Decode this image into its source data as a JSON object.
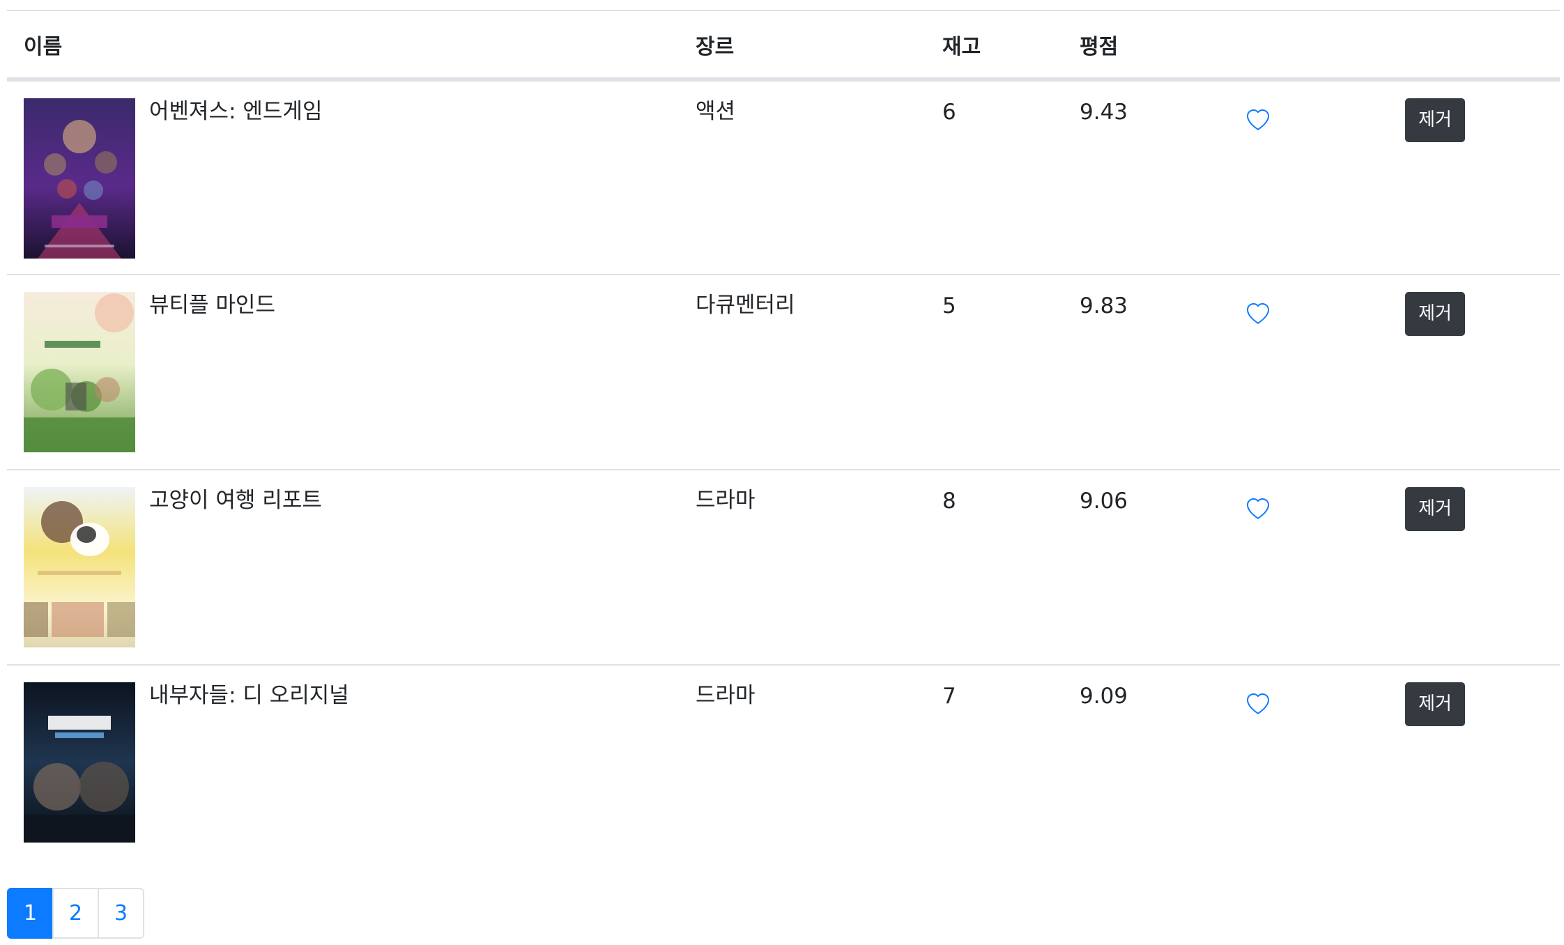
{
  "table": {
    "headers": {
      "title": "이름",
      "genre": "장르",
      "stock": "재고",
      "rate": "평점"
    },
    "rows": [
      {
        "poster_icon": "movie-poster-image",
        "poster_colors": [
          "#2b1b4a",
          "#7b2fa0",
          "#c43a6e"
        ],
        "title": "어벤져스: 엔드게임",
        "genre": "액션",
        "stock": "6",
        "rate": "9.43",
        "remove_label": "제거"
      },
      {
        "poster_icon": "movie-poster-image",
        "poster_colors": [
          "#f3e7d6",
          "#8dbf6c",
          "#3f7a3a"
        ],
        "title": "뷰티플 마인드",
        "genre": "다큐멘터리",
        "stock": "5",
        "rate": "9.83",
        "remove_label": "제거"
      },
      {
        "poster_icon": "movie-poster-image",
        "poster_colors": [
          "#fbf3c9",
          "#f1d84f",
          "#c9b35a"
        ],
        "title": "고양이 여행 리포트",
        "genre": "드라마",
        "stock": "8",
        "rate": "9.06",
        "remove_label": "제거"
      },
      {
        "poster_icon": "movie-poster-image",
        "poster_colors": [
          "#0e1a2b",
          "#233a5c",
          "#111111"
        ],
        "title": "내부자들: 디 오리지널",
        "genre": "드라마",
        "stock": "7",
        "rate": "9.09",
        "remove_label": "제거"
      }
    ]
  },
  "pagination": {
    "pages": [
      "1",
      "2",
      "3"
    ],
    "active": "1"
  },
  "colors": {
    "accent": "#0d7bff",
    "remove_button": "#343a40",
    "heart_icon": "#0d7bff"
  }
}
